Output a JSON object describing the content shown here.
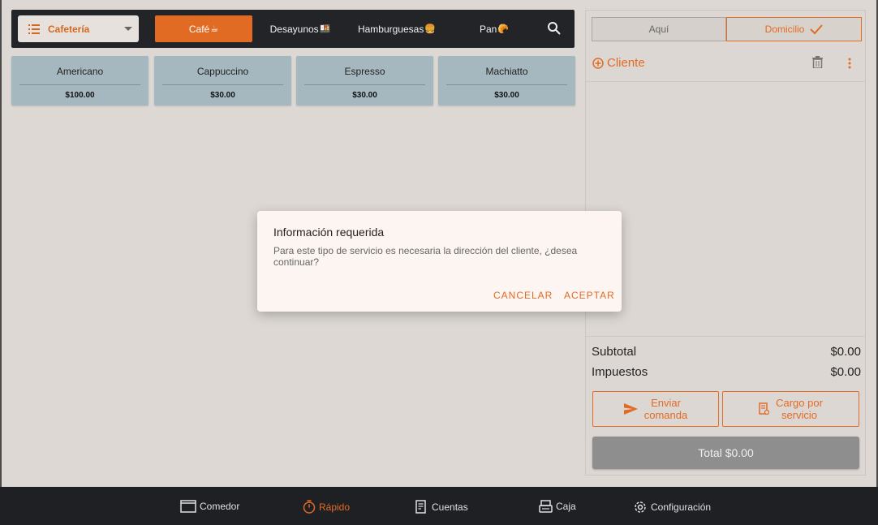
{
  "categoria": {
    "label": "Cafetería"
  },
  "tabs": [
    {
      "label": "Café",
      "emoji": "☕"
    },
    {
      "label": "Desayunos",
      "emoji": "🍱"
    },
    {
      "label": "Hamburguesas",
      "emoji": "🍔"
    },
    {
      "label": "Pan",
      "emoji": "🥐"
    }
  ],
  "productos": [
    {
      "name": "Americano",
      "price": "$100.00"
    },
    {
      "name": "Cappuccino",
      "price": "$30.00"
    },
    {
      "name": "Espresso",
      "price": "$30.00"
    },
    {
      "name": "Machiatto",
      "price": "$30.00"
    }
  ],
  "servicio": {
    "aqui": "Aquí",
    "domicilio": "Domicilio"
  },
  "cliente": {
    "label": "Cliente"
  },
  "resumen": {
    "subtotal_label": "Subtotal",
    "subtotal_value": "$0.00",
    "impuestos_label": "Impuestos",
    "impuestos_value": "$0.00"
  },
  "acciones": {
    "enviar_l1": "Enviar",
    "enviar_l2": "comanda",
    "cargo_l1": "Cargo por",
    "cargo_l2": "servicio",
    "total": "Total $0.00"
  },
  "nav": [
    {
      "label": "Comedor"
    },
    {
      "label": "Rápido"
    },
    {
      "label": "Cuentas"
    },
    {
      "label": "Caja"
    },
    {
      "label": "Configuración"
    }
  ],
  "dialogo": {
    "title": "Información requerida",
    "message": "Para este tipo de servicio es necesaria la dirección del cliente, ¿desea continuar?",
    "cancel": "CANCELAR",
    "accept": "ACEPTAR"
  },
  "colors": {
    "accent": "#e26b24",
    "bar": "#232428",
    "card": "#a6b8bf"
  }
}
